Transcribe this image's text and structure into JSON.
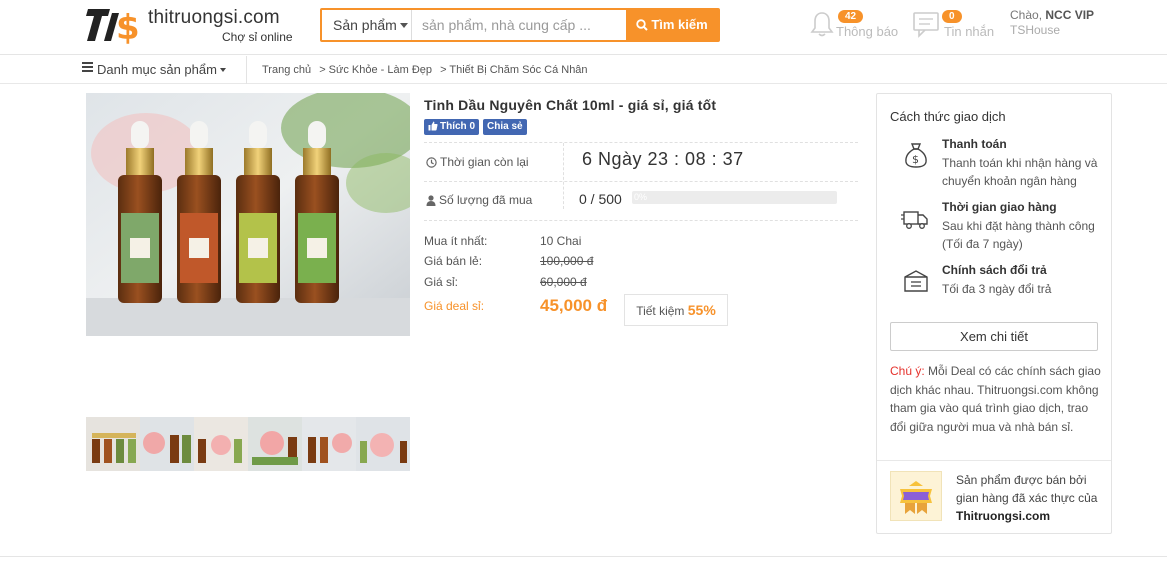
{
  "header": {
    "logo_text": "thitruongsi.com",
    "logo_sub": "Chợ sỉ online",
    "search": {
      "category": "Sản phẩm",
      "placeholder": "sản phẩm, nhà cung cấp ...",
      "button": "Tìm kiếm"
    },
    "notifications": {
      "count": "42",
      "label": "Thông báo",
      "icon": "bell-icon"
    },
    "messages": {
      "count": "0",
      "label": "Tin nhắn",
      "icon": "message-icon"
    },
    "user": {
      "greeting": "Chào,",
      "name": "NCC VIP",
      "shop": "TSHouse"
    }
  },
  "subnav": {
    "category_menu": "Danh mục sản phẩm",
    "breadcrumb": [
      "Trang chủ",
      "> Sức Khỏe - Làm Đẹp",
      "> Thiết Bị Chăm Sóc Cá Nhân"
    ]
  },
  "product": {
    "title": "Tinh Dầu Nguyên Chất 10ml - giá sỉ, giá tốt",
    "like_label": "Thích 0",
    "share_label": "Chia sẻ",
    "time_label": "Thời gian còn lại",
    "countdown": "6 Ngày 23 : 08 : 37",
    "sold_label": "Số lượng đã mua",
    "sold_value": "0 / 500",
    "progress_text": "0%",
    "progress_fraction": 0,
    "min_order_label": "Mua ít nhất:",
    "min_order_value": "10 Chai",
    "retail_label": "Giá bán lẻ:",
    "retail_value": "100,000 đ",
    "wholesale_label": "Giá sỉ:",
    "wholesale_value": "60,000 đ",
    "deal_label": "Giá deal sỉ:",
    "deal_value": "45,000 đ",
    "saving_label": "Tiết kiệm",
    "saving_value": "55%",
    "thumbnail_count": 6
  },
  "sidebar": {
    "title": "Cách thức giao dịch",
    "items": [
      {
        "icon": "money-bag-icon",
        "heading": "Thanh toán",
        "desc": "Thanh toán khi nhận hàng và chuyển khoản ngân hàng"
      },
      {
        "icon": "delivery-truck-icon",
        "heading": "Thời gian giao hàng",
        "desc": "Sau khi đặt hàng thành công (Tối đa 7 ngày)"
      },
      {
        "icon": "return-box-icon",
        "heading": "Chính sách đổi trả",
        "desc": "Tối đa 3 ngày đổi trả"
      }
    ],
    "detail_button": "Xem chi tiết",
    "note_prefix": "Chú ý:",
    "note_text": " Mỗi Deal có các chính sách giao dịch khác nhau. Thitruongsi.com không tham gia vào quá trình giao dịch, trao đổi giữa người mua và nhà bán sỉ.",
    "verify_text": "Sản phẩm được bán bởi gian hàng đã xác thực của ",
    "verify_brand": "Thitruongsi.com"
  },
  "colors": {
    "accent": "#f7922a",
    "facebook": "#4267b2",
    "warning": "#e5322d"
  }
}
